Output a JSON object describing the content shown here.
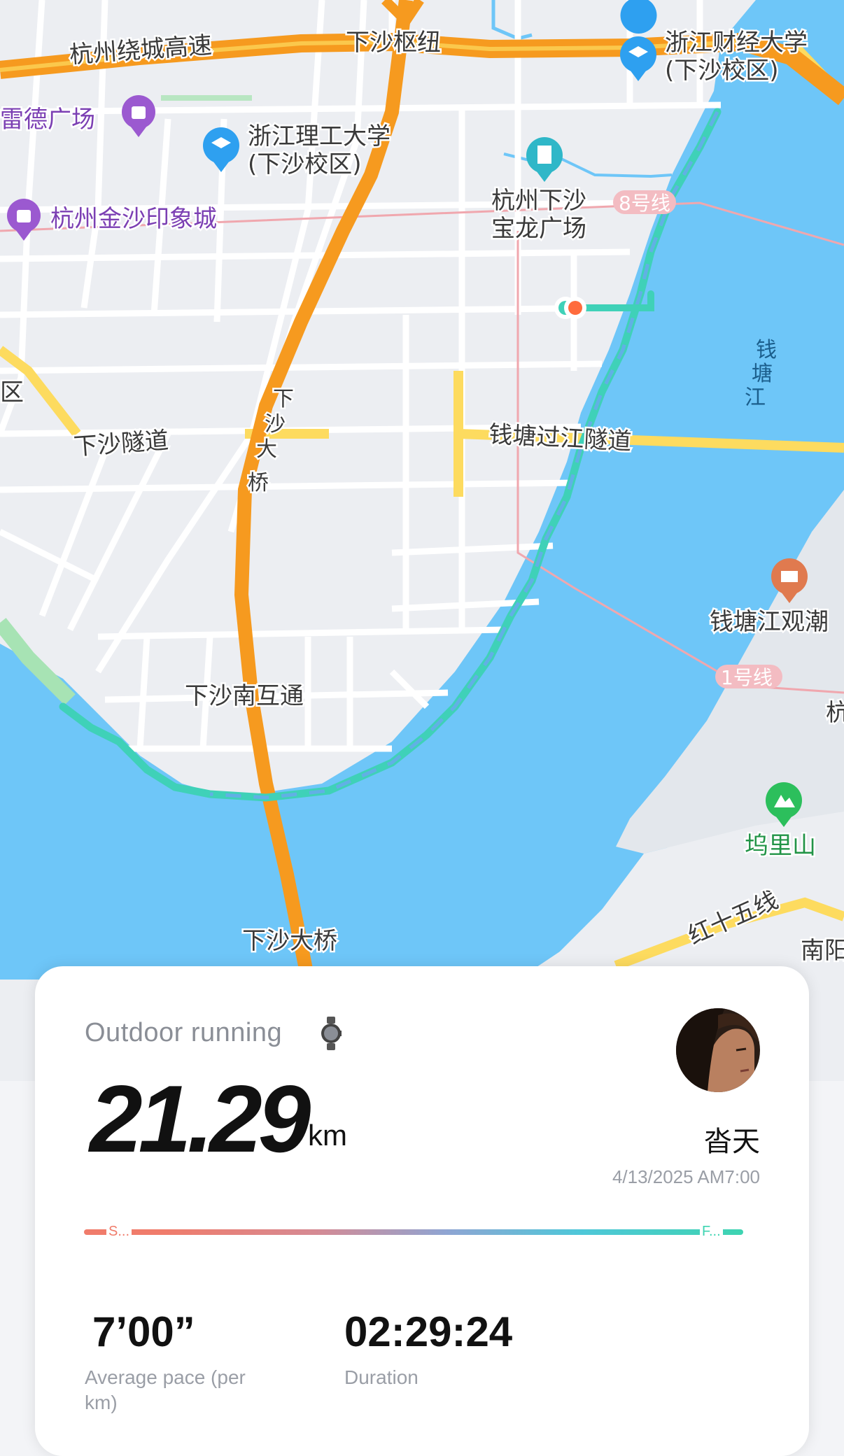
{
  "map": {
    "labels": {
      "expressway": "杭州绕城高速",
      "hub": "下沙枢纽",
      "univ_finance_1": "浙江财经大学",
      "univ_finance_2": "(下沙校区)",
      "plaza_left": "雷德广场",
      "univ_tech_1": "浙江理工大学",
      "univ_tech_2": "(下沙校区)",
      "mall": "杭州金沙印象城",
      "baolong_1": "杭州下沙",
      "baolong_2": "宝龙广场",
      "metro8": "8号线",
      "river_1": "钱",
      "river_2": "塘",
      "river_3": "江",
      "edge_qu": "区",
      "tunnel_left": "下沙隧道",
      "bridge_vertical_1": "下",
      "bridge_vertical_2": "沙",
      "bridge_vertical_3": "大",
      "bridge_vertical_4": "桥",
      "tunnel_right": "钱塘过江隧道",
      "tide_view": "钱塘江观潮",
      "metro1": "1号线",
      "edge_hang": "杭",
      "interchange": "下沙南互通",
      "mountain": "坞里山",
      "road_hongshiwu": "红十五线",
      "edge_nanyang": "南阳",
      "bridge_bottom": "下沙大桥"
    },
    "colors": {
      "water": "#6ec6f8",
      "land": "#eceef2",
      "road": "#ffffff",
      "highway": "#f69a1f",
      "yellow_road": "#fddb5f",
      "route": "#3fd1b8",
      "route_alt": "#6aa8f0"
    }
  },
  "card": {
    "activity": "Outdoor running",
    "watch_icon": "smartwatch-icon",
    "distance": "21.29",
    "unit": "km",
    "username": "沓天",
    "datetime": "4/13/2025 AM7:00",
    "progress_start": "S...",
    "progress_end": "F...",
    "pace_value": "7’00”",
    "pace_label": "Average pace (per km)",
    "duration_value": "02:29:24",
    "duration_label": "Duration"
  }
}
